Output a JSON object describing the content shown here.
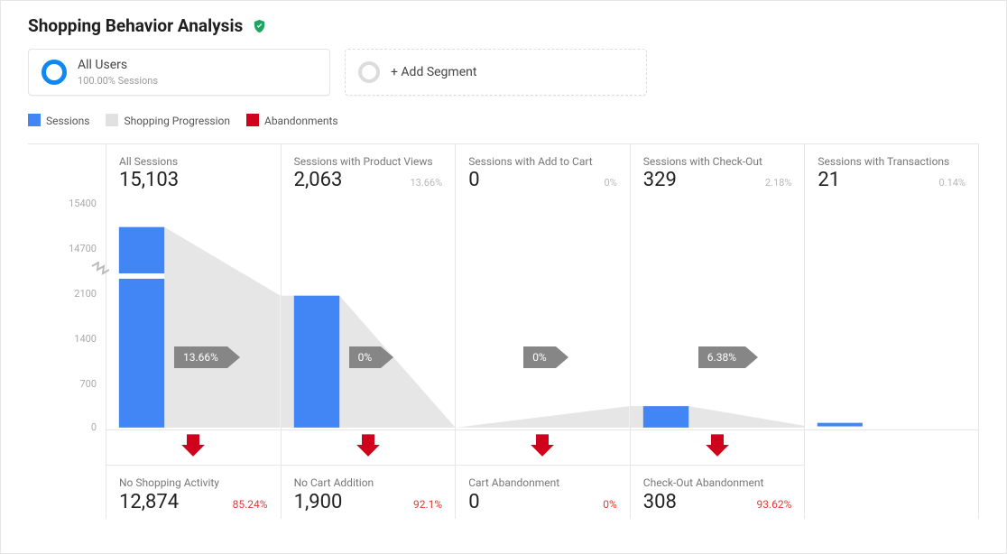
{
  "title": "Shopping Behavior Analysis",
  "segments": {
    "active": {
      "name": "All Users",
      "sub": "100.00% Sessions"
    },
    "add": "+ Add Segment"
  },
  "legend": {
    "sessions": "Sessions",
    "progression": "Shopping Progression",
    "abandon": "Abandonments"
  },
  "stages": [
    {
      "label": "All Sessions",
      "value": "15,103",
      "pct": "",
      "progress_chip": "13.66%"
    },
    {
      "label": "Sessions with Product Views",
      "value": "2,063",
      "pct": "13.66%",
      "progress_chip": "0%"
    },
    {
      "label": "Sessions with Add to Cart",
      "value": "0",
      "pct": "0%",
      "progress_chip": "0%"
    },
    {
      "label": "Sessions with Check-Out",
      "value": "329",
      "pct": "2.18%",
      "progress_chip": "6.38%"
    },
    {
      "label": "Sessions with Transactions",
      "value": "21",
      "pct": "0.14%",
      "progress_chip": ""
    }
  ],
  "abandon": [
    {
      "label": "No Shopping Activity",
      "value": "12,874",
      "pct": "85.24%"
    },
    {
      "label": "No Cart Addition",
      "value": "1,900",
      "pct": "92.1%"
    },
    {
      "label": "Cart Abandonment",
      "value": "0",
      "pct": "0%"
    },
    {
      "label": "Check-Out Abandonment",
      "value": "308",
      "pct": "93.62%"
    }
  ],
  "chart_data": {
    "type": "bar",
    "title": "Shopping Behavior Analysis",
    "y_ticks_upper": [
      14700,
      15400
    ],
    "y_ticks_lower": [
      0,
      700,
      1400,
      2100
    ],
    "axis_break": true,
    "categories": [
      "All Sessions",
      "Sessions with Product Views",
      "Sessions with Add to Cart",
      "Sessions with Check-Out",
      "Sessions with Transactions"
    ],
    "series": [
      {
        "name": "Sessions",
        "values": [
          15103,
          2063,
          0,
          329,
          21
        ],
        "pct_of_all": [
          null,
          13.66,
          0,
          2.18,
          0.14
        ],
        "color": "#4285f4"
      },
      {
        "name": "Shopping Progression (to next stage, %)",
        "values": [
          13.66,
          0,
          0,
          6.38,
          null
        ],
        "color": "#e1e1e1"
      },
      {
        "name": "Abandonments",
        "values": [
          12874,
          1900,
          0,
          308,
          null
        ],
        "pct": [
          85.24,
          92.1,
          0,
          93.62,
          null
        ],
        "labels": [
          "No Shopping Activity",
          "No Cart Addition",
          "Cart Abandonment",
          "Check-Out Abandonment",
          null
        ],
        "color": "#d0021b"
      }
    ],
    "xlabel": "",
    "ylabel": ""
  }
}
